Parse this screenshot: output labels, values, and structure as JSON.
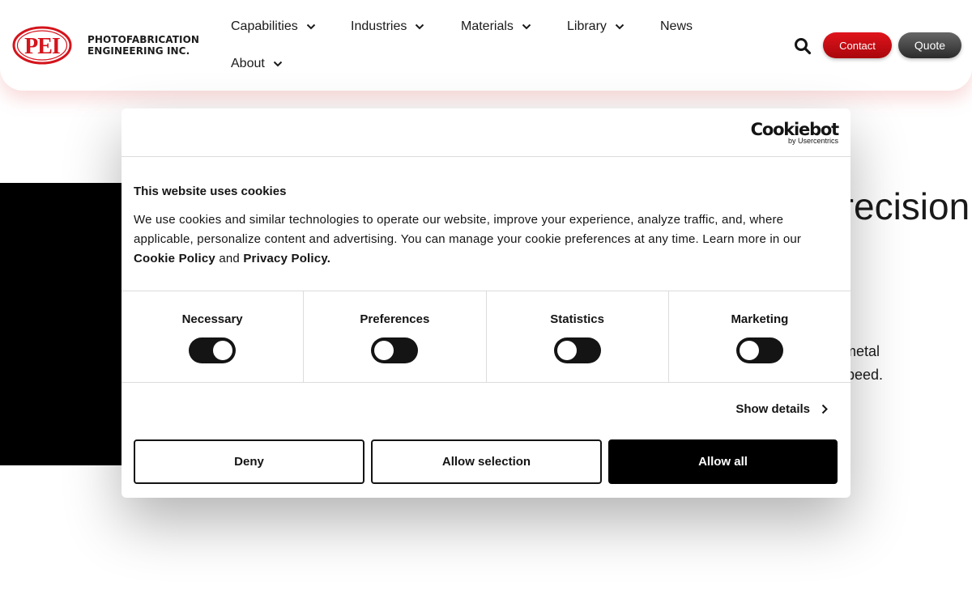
{
  "brand": {
    "logo_text": "PEI",
    "company_line1": "PHOTOFABRICATION",
    "company_line2": "ENGINEERING INC."
  },
  "nav": {
    "items": [
      {
        "label": "Capabilities",
        "has_dropdown": true
      },
      {
        "label": "Industries",
        "has_dropdown": true
      },
      {
        "label": "Materials",
        "has_dropdown": true
      },
      {
        "label": "Library",
        "has_dropdown": true
      },
      {
        "label": "News",
        "has_dropdown": false
      },
      {
        "label": "About",
        "has_dropdown": true
      }
    ],
    "search_icon": "search-icon",
    "contact_label": "Contact",
    "quote_label": "Quote"
  },
  "hero": {
    "title_fragment": "Precision",
    "text_line1": "metal",
    "text_line2": "speed."
  },
  "cookie": {
    "brand_big": "Cookiebot",
    "brand_small": "by Usercentrics",
    "heading": "This website uses cookies",
    "body": "We use cookies and similar technologies to operate our website, improve your experience, analyze traffic, and, where applicable, personalize content and advertising. You can manage your cookie preferences at any time. Learn more in our ",
    "cookie_policy": "Cookie Policy",
    "and": " and ",
    "privacy_policy": "Privacy Policy.",
    "toggles": [
      {
        "label": "Necessary",
        "state": "on"
      },
      {
        "label": "Preferences",
        "state": "off"
      },
      {
        "label": "Statistics",
        "state": "off"
      },
      {
        "label": "Marketing",
        "state": "off"
      }
    ],
    "show_details": "Show details",
    "deny": "Deny",
    "allow_selection": "Allow selection",
    "allow_all": "Allow all"
  },
  "colors": {
    "accent_red": "#d4141c",
    "dark": "#141414"
  }
}
